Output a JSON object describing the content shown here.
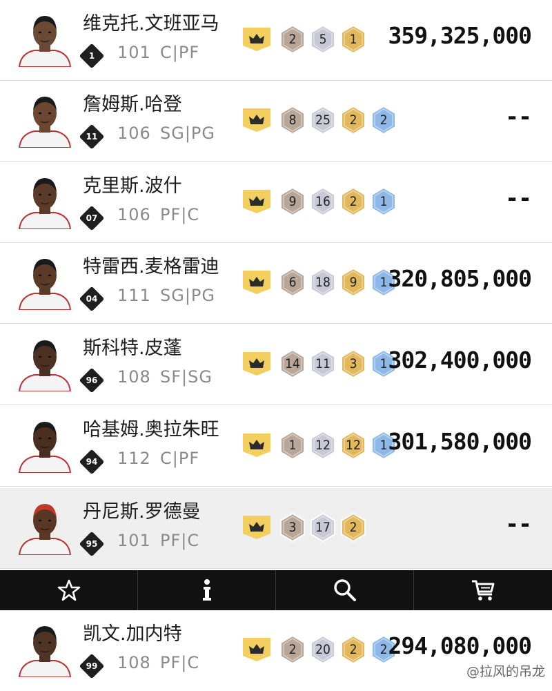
{
  "players": [
    {
      "name": "维克托.文班亚马",
      "jersey": "1",
      "ovr": "101",
      "pos": "C|PF",
      "badges": [
        "2",
        "5",
        "1"
      ],
      "amount": "359,325,000",
      "skin": "#6b4a35"
    },
    {
      "name": "詹姆斯.哈登",
      "jersey": "11",
      "ovr": "106",
      "pos": "SG|PG",
      "badges": [
        "8",
        "25",
        "2",
        "2"
      ],
      "amount": "--",
      "skin": "#6b4630"
    },
    {
      "name": "克里斯.波什",
      "jersey": "07",
      "ovr": "106",
      "pos": "PF|C",
      "badges": [
        "9",
        "16",
        "2",
        "1"
      ],
      "amount": "--",
      "skin": "#5a3a28"
    },
    {
      "name": "特雷西.麦格雷迪",
      "jersey": "04",
      "ovr": "111",
      "pos": "SG|PG",
      "badges": [
        "6",
        "18",
        "9",
        "1"
      ],
      "amount": "320,805,000",
      "skin": "#5c3a28"
    },
    {
      "name": "斯科特.皮蓬",
      "jersey": "96",
      "ovr": "108",
      "pos": "SF|SG",
      "badges": [
        "14",
        "11",
        "3",
        "1"
      ],
      "amount": "302,400,000",
      "skin": "#4c3022"
    },
    {
      "name": "哈基姆.奥拉朱旺",
      "jersey": "94",
      "ovr": "112",
      "pos": "C|PF",
      "badges": [
        "1",
        "12",
        "12",
        "1"
      ],
      "amount": "301,580,000",
      "skin": "#4a2e20"
    },
    {
      "name": "丹尼斯.罗德曼",
      "jersey": "95",
      "ovr": "101",
      "pos": "PF|C",
      "badges": [
        "3",
        "17",
        "2"
      ],
      "amount": "--",
      "skin": "#5a3625"
    },
    {
      "name": "凯文.加内特",
      "jersey": "99",
      "ovr": "108",
      "pos": "PF|C",
      "badges": [
        "2",
        "20",
        "2",
        "2"
      ],
      "amount": "294,080,000",
      "skin": "#4f3426"
    }
  ],
  "badge_colors": {
    "hof": "#b8a798",
    "gold": "#c7cad6",
    "silver": "#e2b85c",
    "bronze": "#8db8e8",
    "crown": "#f2cf5e"
  },
  "tabs": [
    {
      "icon": "star-icon"
    },
    {
      "icon": "info-icon"
    },
    {
      "icon": "search-icon"
    },
    {
      "icon": "cart-icon"
    }
  ],
  "watermark": "@拉风的吊龙"
}
